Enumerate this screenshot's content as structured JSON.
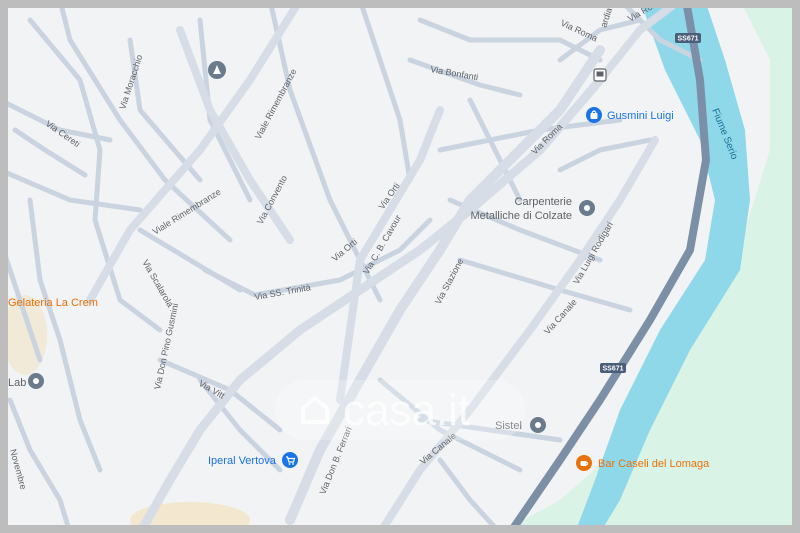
{
  "map": {
    "colors": {
      "background": "#f2f3f5",
      "road": "#c9d4e0",
      "main_road": "#d6dde6",
      "motorway": "#7b8fa6",
      "river": "#8fd8ea",
      "park": "#d9f3e6",
      "poi_blue": "#1a73e8",
      "poi_orange": "#e8710a",
      "poi_gray": "#5f6368"
    },
    "streets": [
      "Via Roma",
      "Via Roma",
      "Via Roma",
      "Via Bonfanti",
      "Via Moracchio",
      "Viale Rimembranze",
      "Viale Rimembranze",
      "Via Cereti",
      "Via Convento",
      "Via Orti",
      "Via Orti",
      "Via C. B. Cavour",
      "Via Stazione",
      "Via SS. Trinità",
      "Via Scalarola",
      "Via Don Pino Gusmini",
      "Via Vitt",
      "Via Don B. Ferrari",
      "Via Canale",
      "Via Canale",
      "Via Luigi Rodigari",
      "Novembre",
      "ardia"
    ],
    "pois": [
      {
        "name": "Gusmini Luigi",
        "icon": "shopping-bag-icon",
        "color": "blue"
      },
      {
        "name": "Carpenterie Metalliche di Colzate",
        "icon": "place-pin-icon",
        "color": "gray"
      },
      {
        "name": "Gelateria La Crem",
        "icon": "none",
        "color": "orange"
      },
      {
        "name": "Lab",
        "icon": "place-pin-icon",
        "color": "gray"
      },
      {
        "name": "Sistel",
        "icon": "place-pin-icon",
        "color": "gray"
      },
      {
        "name": "Iperal Vertova",
        "icon": "shopping-cart-icon",
        "color": "blue"
      },
      {
        "name": "Bar Caseli del Lomaga",
        "icon": "cafe-icon",
        "color": "orange"
      }
    ],
    "river_name": "Fiume Serio",
    "route_shields": [
      "SS671",
      "SS671"
    ],
    "icons": [
      "monument-icon",
      "bus-stop-icon"
    ],
    "watermark": "casa.it"
  }
}
